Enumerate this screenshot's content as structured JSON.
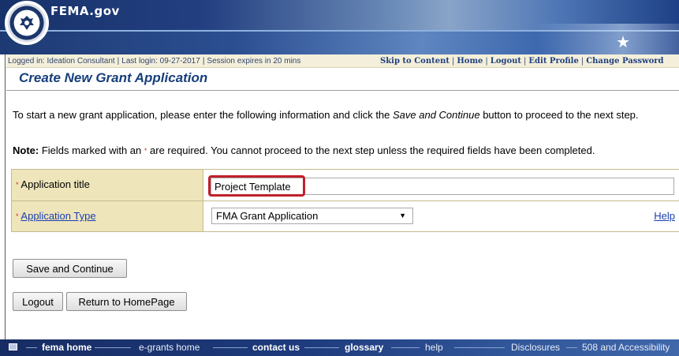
{
  "header": {
    "site_title": "FEMA.gov",
    "seal_icon": "dhs-seal-icon"
  },
  "status_bar": {
    "logged_in": "Logged in: Ideation Consultant",
    "last_login": "Last login: 09-27-2017",
    "session": "Session expires in 20 mins",
    "links": [
      "Skip to Content",
      "Home",
      "Logout",
      "Edit Profile",
      "Change Password"
    ]
  },
  "page": {
    "title": "Create New Grant Application",
    "intro_prefix": "To start a new grant application, please enter the following information and click the ",
    "intro_emphasis": "Save and Continue",
    "intro_suffix": " button to proceed to the next step.",
    "note_label": "Note:",
    "note_prefix": " Fields marked with an ",
    "required_marker": "*",
    "note_suffix": " are required. You cannot proceed to the next step unless the required fields have been completed."
  },
  "form": {
    "application_title": {
      "label": "Application title",
      "value": "Project Template"
    },
    "application_type": {
      "label": "Application Type",
      "selected": "FMA Grant Application",
      "help": "Help"
    }
  },
  "buttons": {
    "save_continue": "Save and Continue",
    "logout": "Logout",
    "return_home": "Return to HomePage"
  },
  "footer": {
    "links": [
      "fema home",
      "e-grants home",
      "contact us",
      "glossary",
      "help",
      "Disclosures",
      "508 and Accessibility"
    ]
  },
  "colors": {
    "accent": "#173f7a",
    "label_bg": "#efe5bb",
    "highlight": "#c0202a"
  }
}
